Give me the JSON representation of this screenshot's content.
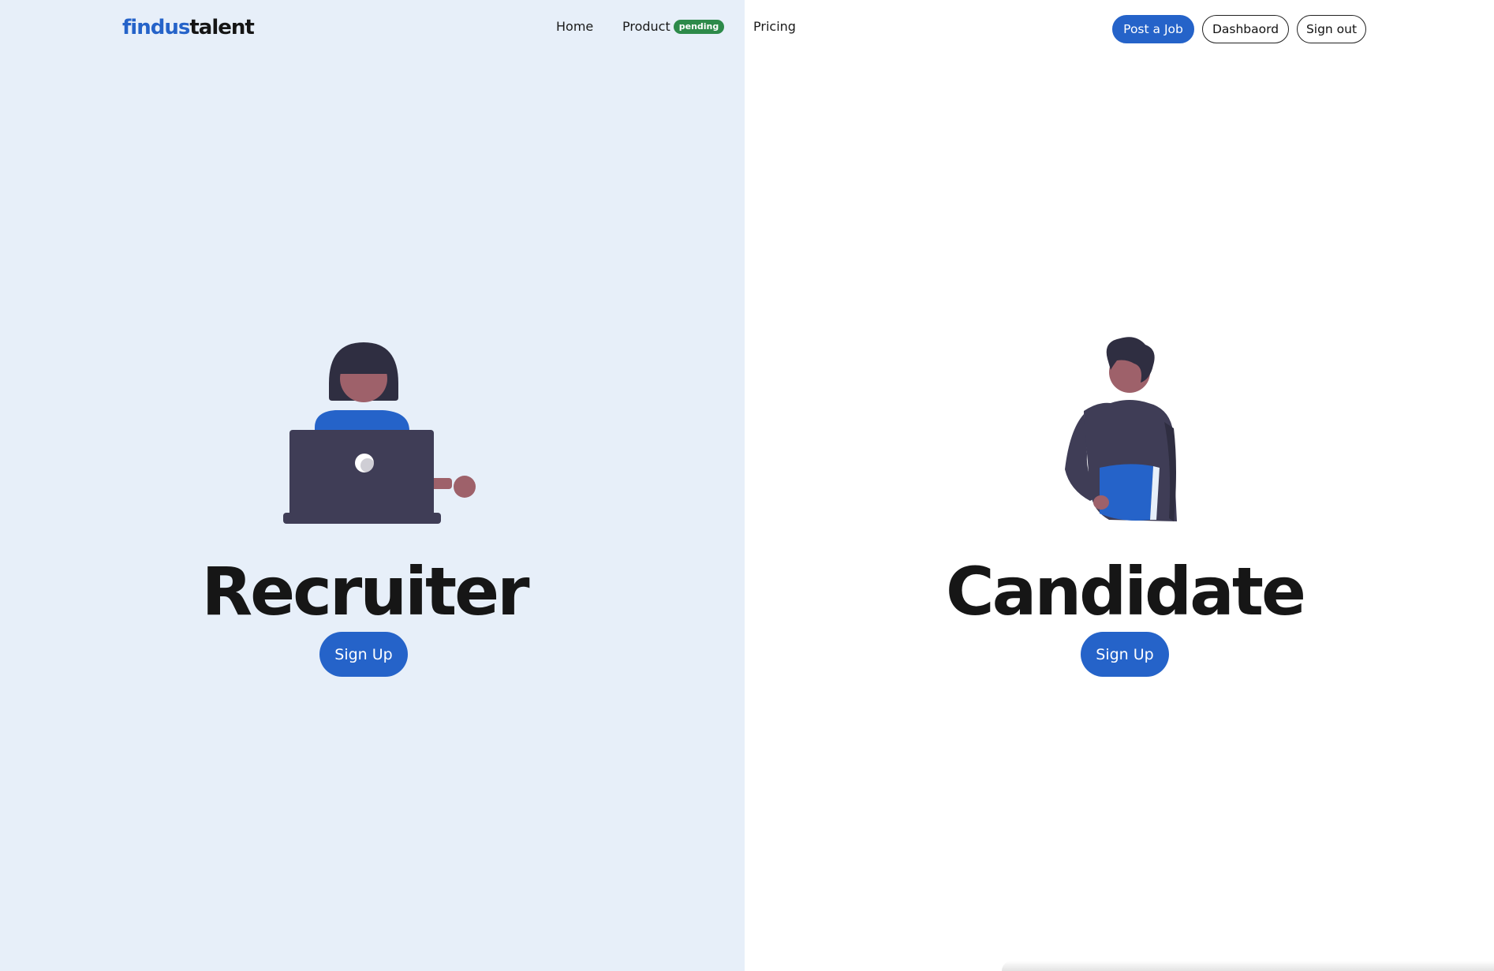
{
  "header": {
    "logo": {
      "part1": "findus",
      "part2": "talent"
    },
    "nav": {
      "home": "Home",
      "product": "Product",
      "product_badge": "pending",
      "pricing": "Pricing"
    },
    "actions": {
      "post_job": "Post a Job",
      "dashboard": "Dashbaord",
      "sign_out": "Sign out"
    }
  },
  "recruiter": {
    "title": "Recruiter",
    "signup_label": "Sign Up",
    "illustration": "person-with-laptop"
  },
  "candidate": {
    "title": "Candidate",
    "signup_label": "Sign Up",
    "illustration": "person-holding-folder"
  },
  "colors": {
    "brand_blue": "#2563c9",
    "left_background": "#e7eff9",
    "badge_green": "#2d8a4a",
    "dark_text": "#161616",
    "illustration_dark": "#3f3d56",
    "skin": "#9e616a"
  }
}
